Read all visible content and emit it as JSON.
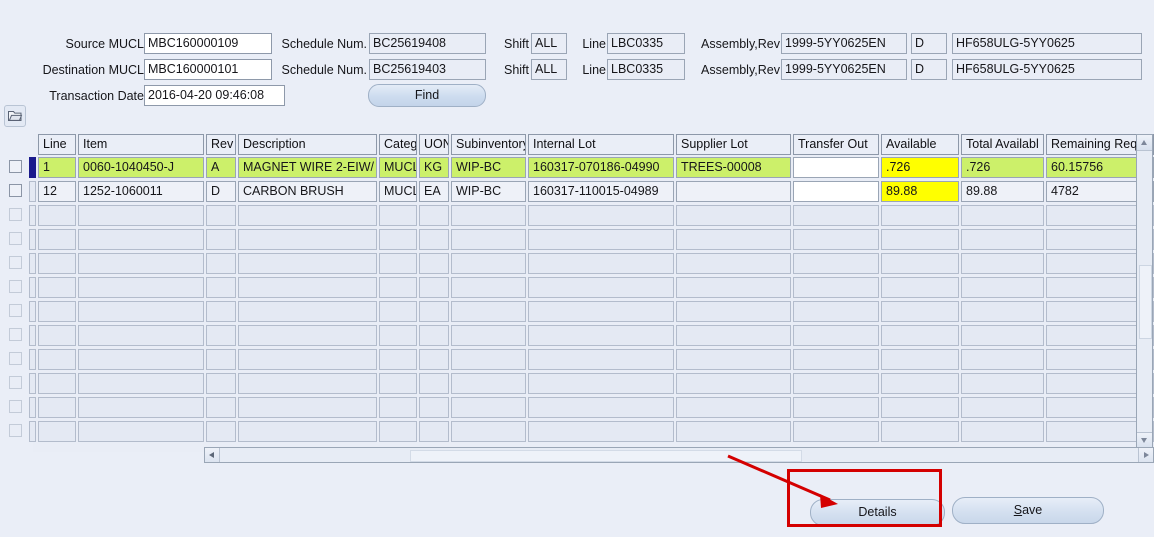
{
  "header": {
    "rows": [
      {
        "label1": "Source MUCL",
        "value1": "MBC160000109",
        "label2": "Schedule Num.",
        "value2": "BC25619408",
        "label3": "Shift",
        "value3": "ALL",
        "label4": "Line",
        "value4": "LBC0335",
        "label5": "Assembly,Rev",
        "value5": "1999-5YY0625EN",
        "value6": "D",
        "value7": "HF658ULG-5YY0625"
      },
      {
        "label1": "Destination MUCL",
        "value1": "MBC160000101",
        "label2": "Schedule Num.",
        "value2": "BC25619403",
        "label3": "Shift",
        "value3": "ALL",
        "label4": "Line",
        "value4": "LBC0335",
        "label5": "Assembly,Rev",
        "value5": "1999-5YY0625EN",
        "value6": "D",
        "value7": "HF658ULG-5YY0625"
      }
    ],
    "transaction_date_label": "Transaction Date",
    "transaction_date_value": "2016-04-20 09:46:08",
    "find_label": "Find"
  },
  "grid": {
    "columns": [
      "Line",
      "Item",
      "Rev",
      "Description",
      "Categ",
      "UON",
      "Subinventory",
      "Internal Lot",
      "Supplier Lot",
      "Transfer Out",
      "Available",
      "Total Availabl",
      "Remaining Req"
    ],
    "rows": [
      {
        "selected": true,
        "highlight": "green",
        "cells": [
          "1",
          "0060-1040450-J",
          "A",
          "MAGNET WIRE 2-EIW/",
          "MUCL",
          "KG",
          "WIP-BC",
          "160317-070186-04990",
          "TREES-00008",
          "",
          ".726",
          ".726",
          "60.15756"
        ]
      },
      {
        "selected": false,
        "highlight": "none",
        "cells": [
          "12",
          "1252-1060011",
          "D",
          "CARBON BRUSH",
          "MUCL",
          "EA",
          "WIP-BC",
          "160317-110015-04989",
          "",
          "",
          "89.88",
          "89.88",
          "4782"
        ]
      }
    ],
    "empty_row_count": 10
  },
  "footer": {
    "details_label": "Details",
    "save_label_prefix": "",
    "save_mnemonic": "S",
    "save_label_suffix": "ave"
  },
  "colors": {
    "window_background": "#eaeef7",
    "field_background": "#e9edf6",
    "highlight_green": "#ccf06a",
    "highlight_yellow": "#ffff00",
    "row_indicator": "#1a1a8c",
    "annotation_red": "#d40000"
  }
}
